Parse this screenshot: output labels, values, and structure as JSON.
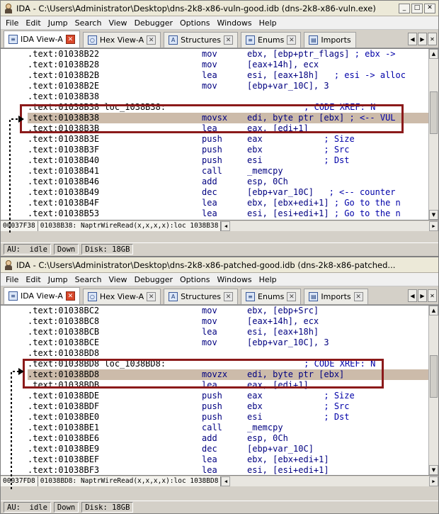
{
  "windows": [
    {
      "title": "IDA - C:\\Users\\Administrator\\Desktop\\dns-2k8-x86-vuln-good.idb (dns-2k8-x86-vuln.exe)",
      "menu": [
        "File",
        "Edit",
        "Jump",
        "Search",
        "View",
        "Debugger",
        "Options",
        "Windows",
        "Help"
      ],
      "tabs": [
        {
          "label": "IDA View-A",
          "active": true
        },
        {
          "label": "Hex View-A",
          "active": false
        },
        {
          "label": "Structures",
          "active": false
        },
        {
          "label": "Enums",
          "active": false
        },
        {
          "label": "Imports",
          "active": false
        }
      ],
      "lines": [
        {
          "addr": ".text:01038B22",
          "mn": "mov",
          "ops": "ebx, [ebp+ptr_flags]",
          "cmt": " ; ebx ->"
        },
        {
          "addr": ".text:01038B28",
          "mn": "mov",
          "ops": "[eax+14h], ecx",
          "cmt": ""
        },
        {
          "addr": ".text:01038B2B",
          "mn": "lea",
          "ops": "esi, [eax+18h]",
          "cmt": "   ; esi -> alloc"
        },
        {
          "addr": ".text:01038B2E",
          "mn": "mov",
          "ops": "[ebp+var_10C], 3",
          "cmt": ""
        },
        {
          "addr": ".text:01038B38",
          "mn": "",
          "ops": "",
          "cmt": ""
        },
        {
          "addr": ".text:01038B38 loc_1038B38:",
          "mn": "",
          "ops": "",
          "cmt": "                           ; CODE XREF: N",
          "label": true
        },
        {
          "addr": ".text:01038B38",
          "mn": "movsx",
          "ops": "edi, byte ptr [ebx]",
          "cmt": " ; <-- VUL",
          "sel": true
        },
        {
          "addr": ".text:01038B3B",
          "mn": "lea",
          "ops": "eax, [edi+1]",
          "cmt": ""
        },
        {
          "addr": ".text:01038B3E",
          "mn": "push",
          "ops": "eax",
          "cmt": "            ; Size"
        },
        {
          "addr": ".text:01038B3F",
          "mn": "push",
          "ops": "ebx",
          "cmt": "            ; Src"
        },
        {
          "addr": ".text:01038B40",
          "mn": "push",
          "ops": "esi",
          "cmt": "            ; Dst"
        },
        {
          "addr": ".text:01038B41",
          "mn": "call",
          "ops": "_memcpy",
          "cmt": ""
        },
        {
          "addr": ".text:01038B46",
          "mn": "add",
          "ops": "esp, 0Ch",
          "cmt": ""
        },
        {
          "addr": ".text:01038B49",
          "mn": "dec",
          "ops": "[ebp+var_10C]",
          "cmt": "   ; <-- counter"
        },
        {
          "addr": ".text:01038B4F",
          "mn": "lea",
          "ops": "ebx, [ebx+edi+1]",
          "cmt": " ; Go to the n"
        },
        {
          "addr": ".text:01038B53",
          "mn": "lea",
          "ops": "esi, [esi+edi+1]",
          "cmt": " ; Go to the n"
        }
      ],
      "status_offset": "00037F38",
      "status_loc": "01038B38: NaptrWireRead(x,x,x,x):loc 1038B38",
      "au_label": "AU:",
      "au_state": "idle",
      "direction": "Down",
      "disk": "Disk: 18GB"
    },
    {
      "title": "IDA - C:\\Users\\Administrator\\Desktop\\dns-2k8-x86-patched-good.idb (dns-2k8-x86-patched...",
      "menu": [
        "File",
        "Edit",
        "Jump",
        "Search",
        "View",
        "Debugger",
        "Options",
        "Windows",
        "Help"
      ],
      "tabs": [
        {
          "label": "IDA View-A",
          "active": true
        },
        {
          "label": "Hex View-A",
          "active": false
        },
        {
          "label": "Structures",
          "active": false
        },
        {
          "label": "Enums",
          "active": false
        },
        {
          "label": "Imports",
          "active": false
        }
      ],
      "lines": [
        {
          "addr": ".text:01038BC2",
          "mn": "mov",
          "ops": "ebx, [ebp+Src]",
          "cmt": ""
        },
        {
          "addr": ".text:01038BC8",
          "mn": "mov",
          "ops": "[eax+14h], ecx",
          "cmt": ""
        },
        {
          "addr": ".text:01038BCB",
          "mn": "lea",
          "ops": "esi, [eax+18h]",
          "cmt": ""
        },
        {
          "addr": ".text:01038BCE",
          "mn": "mov",
          "ops": "[ebp+var_10C], 3",
          "cmt": ""
        },
        {
          "addr": ".text:01038BD8",
          "mn": "",
          "ops": "",
          "cmt": ""
        },
        {
          "addr": ".text:01038BD8 loc_1038BD8:",
          "mn": "",
          "ops": "",
          "cmt": "                           ; CODE XREF: N",
          "label": true
        },
        {
          "addr": ".text:01038BD8",
          "mn": "movzx",
          "ops": "edi, byte ptr [ebx]",
          "cmt": "",
          "sel": true
        },
        {
          "addr": ".text:01038BDB",
          "mn": "lea",
          "ops": "eax, [edi+1]",
          "cmt": ""
        },
        {
          "addr": ".text:01038BDE",
          "mn": "push",
          "ops": "eax",
          "cmt": "            ; Size"
        },
        {
          "addr": ".text:01038BDF",
          "mn": "push",
          "ops": "ebx",
          "cmt": "            ; Src"
        },
        {
          "addr": ".text:01038BE0",
          "mn": "push",
          "ops": "esi",
          "cmt": "            ; Dst"
        },
        {
          "addr": ".text:01038BE1",
          "mn": "call",
          "ops": "_memcpy",
          "cmt": ""
        },
        {
          "addr": ".text:01038BE6",
          "mn": "add",
          "ops": "esp, 0Ch",
          "cmt": ""
        },
        {
          "addr": ".text:01038BE9",
          "mn": "dec",
          "ops": "[ebp+var_10C]",
          "cmt": ""
        },
        {
          "addr": ".text:01038BEF",
          "mn": "lea",
          "ops": "ebx, [ebx+edi+1]",
          "cmt": ""
        },
        {
          "addr": ".text:01038BF3",
          "mn": "lea",
          "ops": "esi, [esi+edi+1]",
          "cmt": ""
        }
      ],
      "status_offset": "00037FD8",
      "status_loc": "01038BD8: NaptrWireRead(x,x,x,x):loc 1038BD8",
      "au_label": "AU:",
      "au_state": "idle",
      "direction": "Down",
      "disk": "Disk: 18GB"
    }
  ],
  "window_buttons": {
    "minimize": "_",
    "maximize": "□",
    "close": "✕"
  },
  "tab_close_glyph": "✕",
  "colors": {
    "selection": "#ccbbaa",
    "highlight_box": "#8b1a1a",
    "code_text": "#000080"
  },
  "icons": {
    "tab_icons": [
      "ida-view-icon",
      "hex-view-icon",
      "structures-icon",
      "enums-icon",
      "imports-icon"
    ]
  }
}
